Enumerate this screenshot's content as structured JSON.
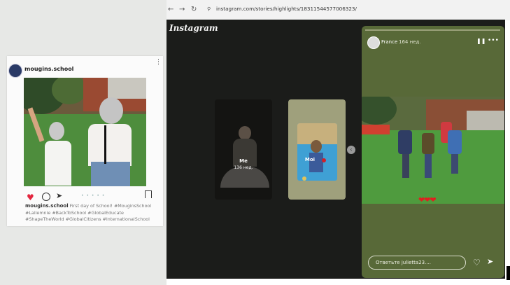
{
  "post": {
    "username": "mougins.school",
    "more": "⋮",
    "caption_user": "mougins.school",
    "caption_text": "First day of School! #MouginsSchool #Lallemnie #BackToSchool #GlobalEducate #ShapeTheWorld #GlobalCitizens #InternationalSchool",
    "carousel_dots": "• • • • •",
    "icons": {
      "like": "♥",
      "send": "➤"
    }
  },
  "browser": {
    "back": "←",
    "forward": "→",
    "reload": "↻",
    "site_icon": "⚲",
    "url": "instagram.com/stories/highlights/18311544577006323/"
  },
  "instagram": {
    "logo": "Instagram",
    "highlights": [
      {
        "title": "Me",
        "count": "136 нед."
      },
      {
        "title": "Moi",
        "count": ""
      }
    ],
    "prev_arrow": "‹",
    "story": {
      "username": "France",
      "time": "164 нед.",
      "hearts": "❤❤❤",
      "reply_placeholder": "Ответьте julietta23....",
      "pause": "❚❚",
      "more": "•••",
      "like": "♡",
      "share": "➤"
    }
  }
}
